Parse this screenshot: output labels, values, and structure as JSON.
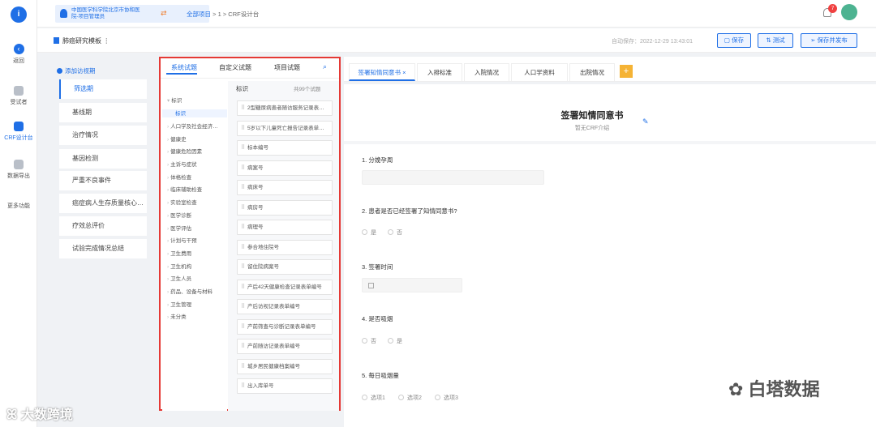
{
  "rail": {
    "back": "返回",
    "items": [
      {
        "label": "受试者"
      },
      {
        "label": "CRF设计台"
      },
      {
        "label": "数据导出"
      },
      {
        "label": "更多功能"
      }
    ]
  },
  "topbar": {
    "org": "中国医学科学院北京市协和医院-项目管理员",
    "crumb_root": "全部项目",
    "crumb_mid": "1",
    "crumb_leaf": "CRF设计台",
    "notif_count": "7"
  },
  "subheader": {
    "template_title": "肺癌研究模板",
    "autosave": "自动保存：2022-12-29 13:43:01",
    "save": "保存",
    "test": "测试",
    "save_publish": "保存并发布"
  },
  "leftnav": {
    "add_visit": "添加访视期",
    "items": [
      "筛选期",
      "基线期",
      "治疗情况",
      "基因检测",
      "严重不良事件",
      "癌症病人生存质量核心…",
      "疗效总评价",
      "试验完成情况总结"
    ]
  },
  "library": {
    "tabs": [
      "系统试题",
      "自定义试题",
      "项目试题"
    ],
    "tree": [
      "标识",
      "标识",
      "人口学及社会经济…",
      "健康史",
      "健康危险因素",
      "主诉与症状",
      "体格检查",
      "临床辅助检查",
      "实验室检查",
      "医学诊断",
      "医学评估",
      "计划与干预",
      "卫生费用",
      "卫生机构",
      "卫生人员",
      "药品、设备与材料",
      "卫生管理",
      "未分类"
    ],
    "list_title": "标识",
    "list_count": "共99个试题",
    "items": [
      "2型糖尿病患者随访服务记录表…",
      "5岁以下儿童死亡报告记录表单…",
      "标本编号",
      "病案号",
      "病床号",
      "病房号",
      "病理号",
      "参合地住院号",
      "留住院病案号",
      "产后42天健康检查记录表单编号",
      "产后访视记录表单编号",
      "产前筛查与诊断记录表单编号",
      "产前随访记录表单编号",
      "城乡居民健康档案编号",
      "出入库单号"
    ]
  },
  "form": {
    "tabs": [
      "签署知情同意书",
      "入排标准",
      "入院情况",
      "人口学资料",
      "出院情况"
    ],
    "title": "签署知情同意书",
    "subtitle": "暂无CRF介绍",
    "questions": [
      {
        "label": "1. 分娩孕周"
      },
      {
        "label": "2. 患者是否已经签署了知情同意书?",
        "options": [
          "是",
          "否"
        ]
      },
      {
        "label": "3. 签署时间"
      },
      {
        "label": "4. 是否吸烟",
        "options": [
          "否",
          "是"
        ]
      },
      {
        "label": "5. 每日吸烟量",
        "options": [
          "选项1",
          "选项2",
          "选项3"
        ]
      }
    ]
  },
  "watermarks": {
    "left": "大数跨境",
    "right": "白塔数据"
  },
  "colors": {
    "accent": "#1f6fe6",
    "highlight_border": "#e53935"
  }
}
